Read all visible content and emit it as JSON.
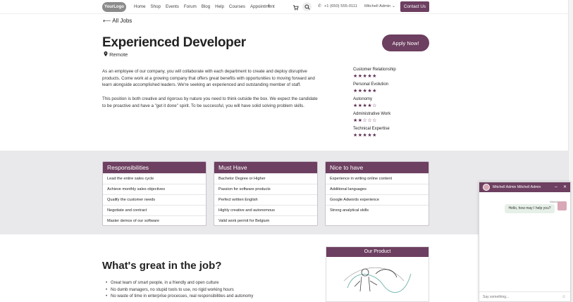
{
  "nav": {
    "logo": "YourLogo",
    "links": [
      "Home",
      "Shop",
      "Events",
      "Forum",
      "Blog",
      "Help",
      "Courses",
      "Appointment"
    ],
    "phone": "+1 (650) 555-0111",
    "user": "Mitchell Admin",
    "contact": "Contact Us"
  },
  "header": {
    "back": "All Jobs",
    "title": "Experienced Developer",
    "location": "Remote",
    "apply": "Apply Now!"
  },
  "description": {
    "p1": "As an employee of our company, you will collaborate with each department to create and deploy disruptive products. Come work at a growing company that offers great benefits with opportunities to moving forward and learn alongside accomplished leaders. We're seeking an experienced and outstanding member of staff.",
    "p2": "This position is both creative and rigorous by nature you need to think outside the box. We expect the candidate to be proactive and have a \"get it done\" spirit. To be successful, you will have solid solving problem skills."
  },
  "skills": [
    {
      "name": "Customer Relationship",
      "stars": "★★★★★",
      "rating": 5
    },
    {
      "name": "Personal Evolution",
      "stars": "★★★★★",
      "rating": 5
    },
    {
      "name": "Autonomy",
      "stars": "★★★★☆",
      "rating": 4
    },
    {
      "name": "Administrative Work",
      "stars": "★★☆☆☆",
      "rating": 2
    },
    {
      "name": "Technical Expertise",
      "stars": "★★★★★",
      "rating": 5
    }
  ],
  "cards": [
    {
      "title": "Responsibilities",
      "rows": [
        "Lead the entire sales cycle",
        "Achieve monthly sales objectives",
        "Qualify the customer needs",
        "Negotiate and contract",
        "Master demos of our software"
      ]
    },
    {
      "title": "Must Have",
      "rows": [
        "Bachelor Degree or Higher",
        "Passion for software products",
        "Perfect written English",
        "Highly creative and autonomous",
        "Valid work permit for Belgium"
      ]
    },
    {
      "title": "Nice to have",
      "rows": [
        "Experience in writing online content",
        "Additional languages",
        "Google Adwords experience",
        "Strong analytical skills"
      ]
    }
  ],
  "great": {
    "title": "What's great in the job?",
    "bullets": [
      "Great team of smart people, in a friendly and open culture",
      "No dumb managers, no stupid tools to use, no rigid working hours",
      "No waste of time in enterprise processes, real responsibilities and autonomy"
    ]
  },
  "product": {
    "title": "Our Product"
  },
  "chat": {
    "title": "Mitchell Admin Mitchell Admin",
    "sender": "Mitchell",
    "message": "Hello, how may I help you?",
    "placeholder": "Say something...",
    "minimize": "–",
    "close": "✕"
  },
  "colors": {
    "brand": "#6d3f60",
    "band": "#e9e9ec"
  }
}
